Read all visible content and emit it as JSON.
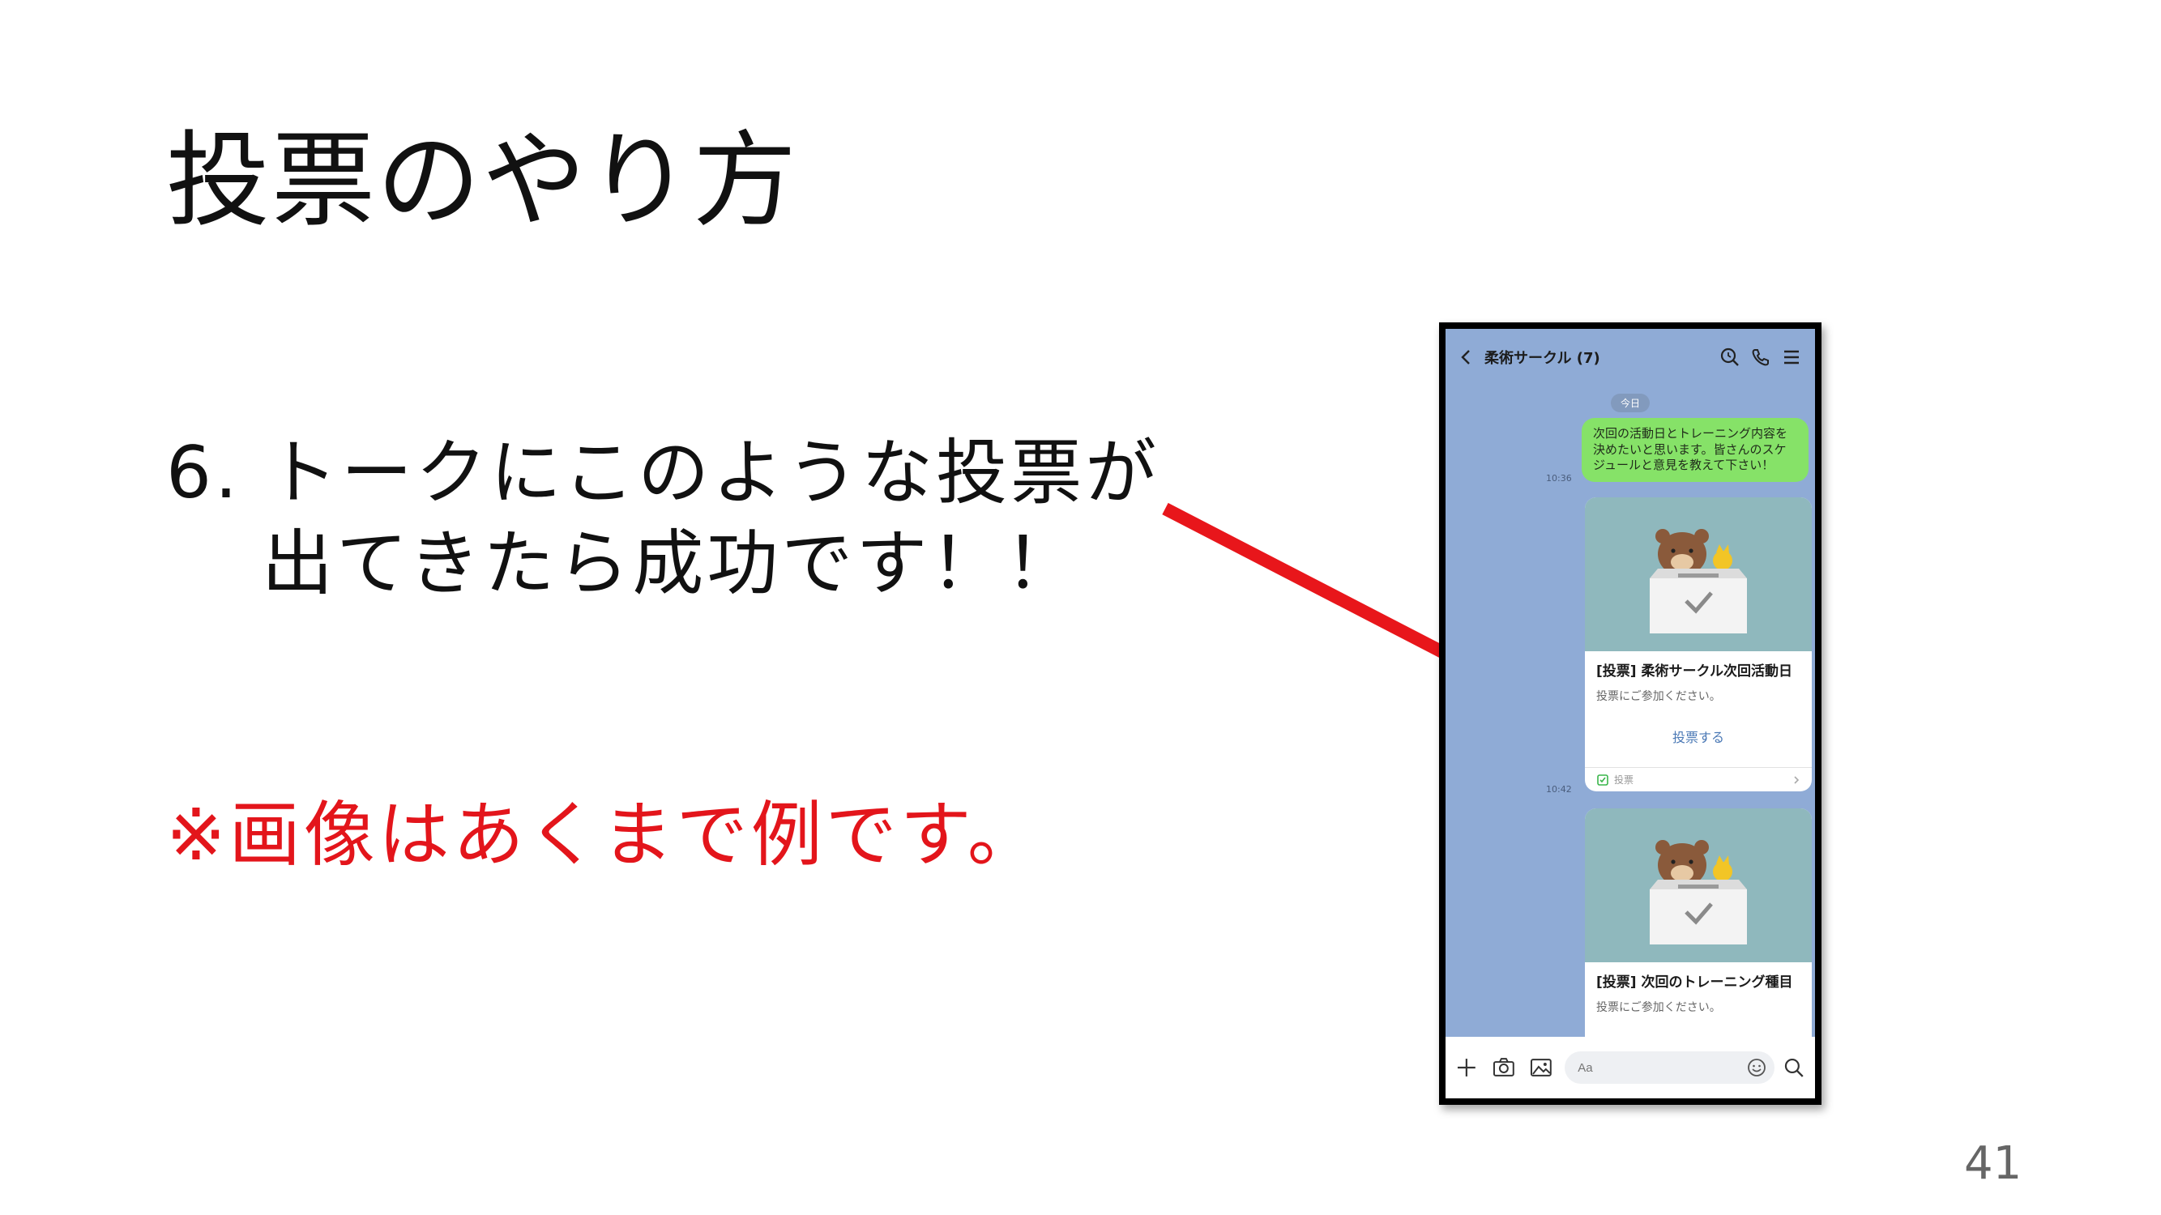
{
  "slide": {
    "title": "投票のやり方",
    "step_line1": "6. トークにこのような投票が",
    "step_line2": "出てきたら成功です！！",
    "note": "※画像はあくまで例です。",
    "page_number": "41",
    "arrow_color": "#e8161b"
  },
  "phone": {
    "chat_title": "柔術サークル (7)",
    "date_label": "今日",
    "messages": [
      {
        "time": "10:36",
        "text": "次回の活動日とトレーニング内容を決めたいと思います。皆さんのスケジュールと意見を教えて下さい！"
      }
    ],
    "polls": [
      {
        "time": "10:42",
        "title": "[投票] 柔術サークル次回活動日",
        "subtitle": "投票にご参加ください。",
        "button": "投票する",
        "footer": "投票"
      },
      {
        "title": "[投票] 次回のトレーニング種目",
        "subtitle": "投票にご参加ください。"
      }
    ],
    "input_placeholder": "Aa",
    "icons": [
      "back-icon",
      "search-icon",
      "phone-icon",
      "menu-icon",
      "plus-icon",
      "camera-icon",
      "image-icon",
      "emoji-icon",
      "search-icon",
      "checkbox-icon",
      "chevron-right-icon"
    ],
    "colors": {
      "chat_background": "#8fabd6",
      "my_bubble": "#86e268",
      "poll_image_bg": "#8fb8bd",
      "link_blue": "#4a78b5"
    }
  }
}
